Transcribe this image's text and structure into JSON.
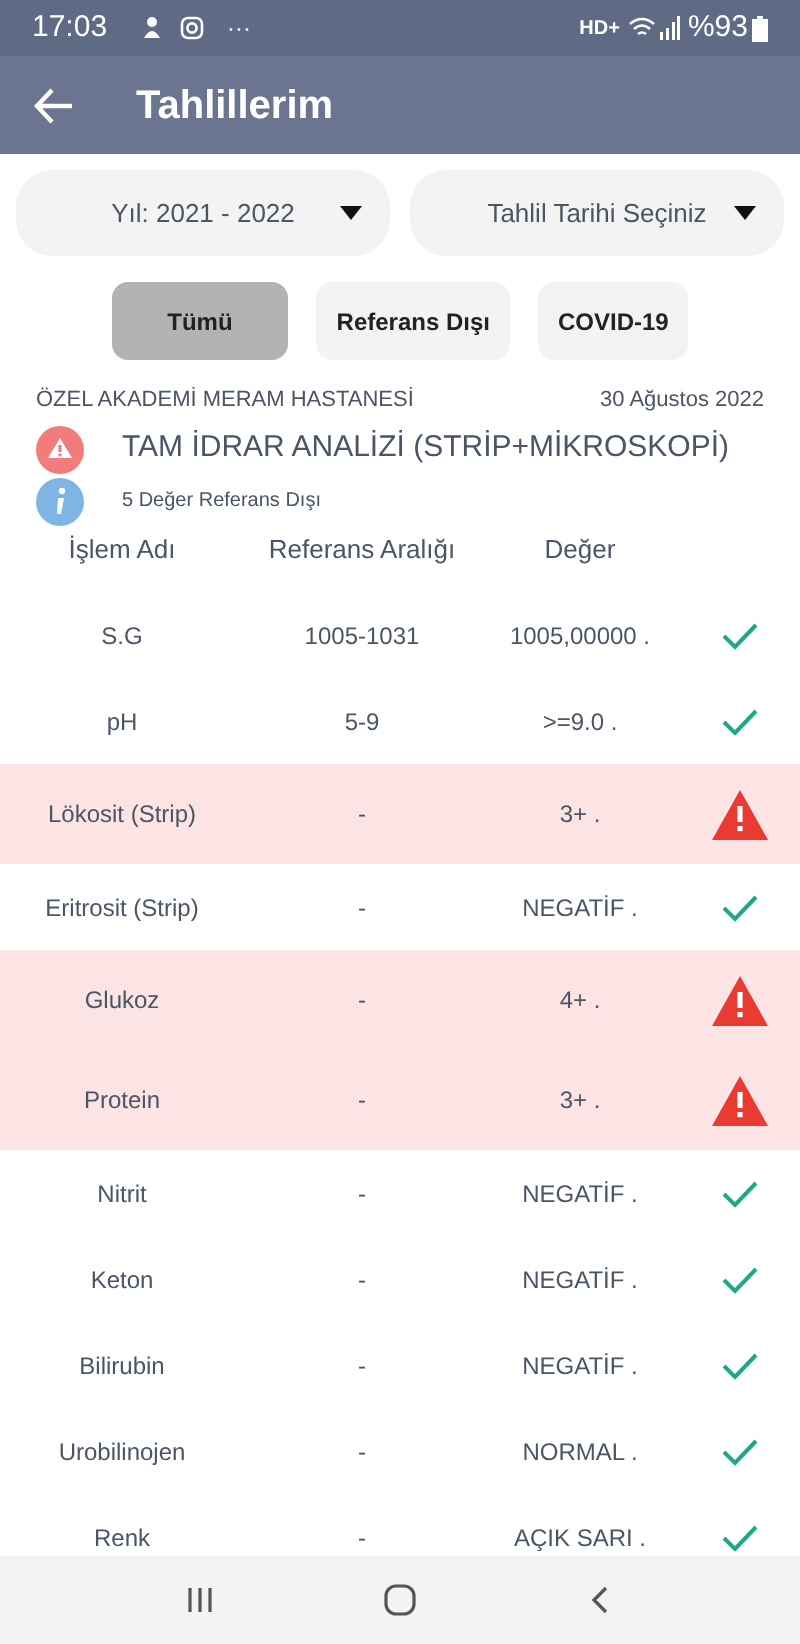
{
  "status_bar": {
    "time": "17:03",
    "more": "···",
    "network": "HD+",
    "battery": "%93"
  },
  "app_bar": {
    "title": "Tahlillerim"
  },
  "filters": [
    {
      "label": "Yıl: 2021 - 2022"
    },
    {
      "label": "Tahlil Tarihi Seçiniz"
    }
  ],
  "tabs": [
    {
      "label": "Tümü",
      "selected": true
    },
    {
      "label": "Referans Dışı",
      "selected": false
    },
    {
      "label": "COVID-19",
      "selected": false
    }
  ],
  "report": {
    "hospital": "ÖZEL AKADEMİ MERAM HASTANESİ",
    "date": "30 Ağustos 2022",
    "title": "TAM İDRAR ANALİZİ (STRİP+MİKROSKOPİ)",
    "note": "5 Değer Referans Dışı"
  },
  "table": {
    "columns": [
      "İşlem Adı",
      "Referans Aralığı",
      "Değer"
    ],
    "rows": [
      {
        "name": "S.G",
        "range": "1005-1031",
        "value": "1005,00000 .",
        "out_of_range": false
      },
      {
        "name": "pH",
        "range": "5-9",
        "value": ">=9.0 .",
        "out_of_range": false
      },
      {
        "name": "Lökosit (Strip)",
        "range": "-",
        "value": "3+ .",
        "out_of_range": true
      },
      {
        "name": "Eritrosit (Strip)",
        "range": "-",
        "value": "NEGATİF .",
        "out_of_range": false
      },
      {
        "name": "Glukoz",
        "range": "-",
        "value": "4+ .",
        "out_of_range": true
      },
      {
        "name": "Protein",
        "range": "-",
        "value": "3+ .",
        "out_of_range": true
      },
      {
        "name": "Nitrit",
        "range": "-",
        "value": "NEGATİF .",
        "out_of_range": false
      },
      {
        "name": "Keton",
        "range": "-",
        "value": "NEGATİF .",
        "out_of_range": false
      },
      {
        "name": "Bilirubin",
        "range": "-",
        "value": "NEGATİF .",
        "out_of_range": false
      },
      {
        "name": "Urobilinojen",
        "range": "-",
        "value": "NORMAL .",
        "out_of_range": false
      },
      {
        "name": "Renk",
        "range": "-",
        "value": "AÇIK SARI .",
        "out_of_range": false
      }
    ]
  }
}
